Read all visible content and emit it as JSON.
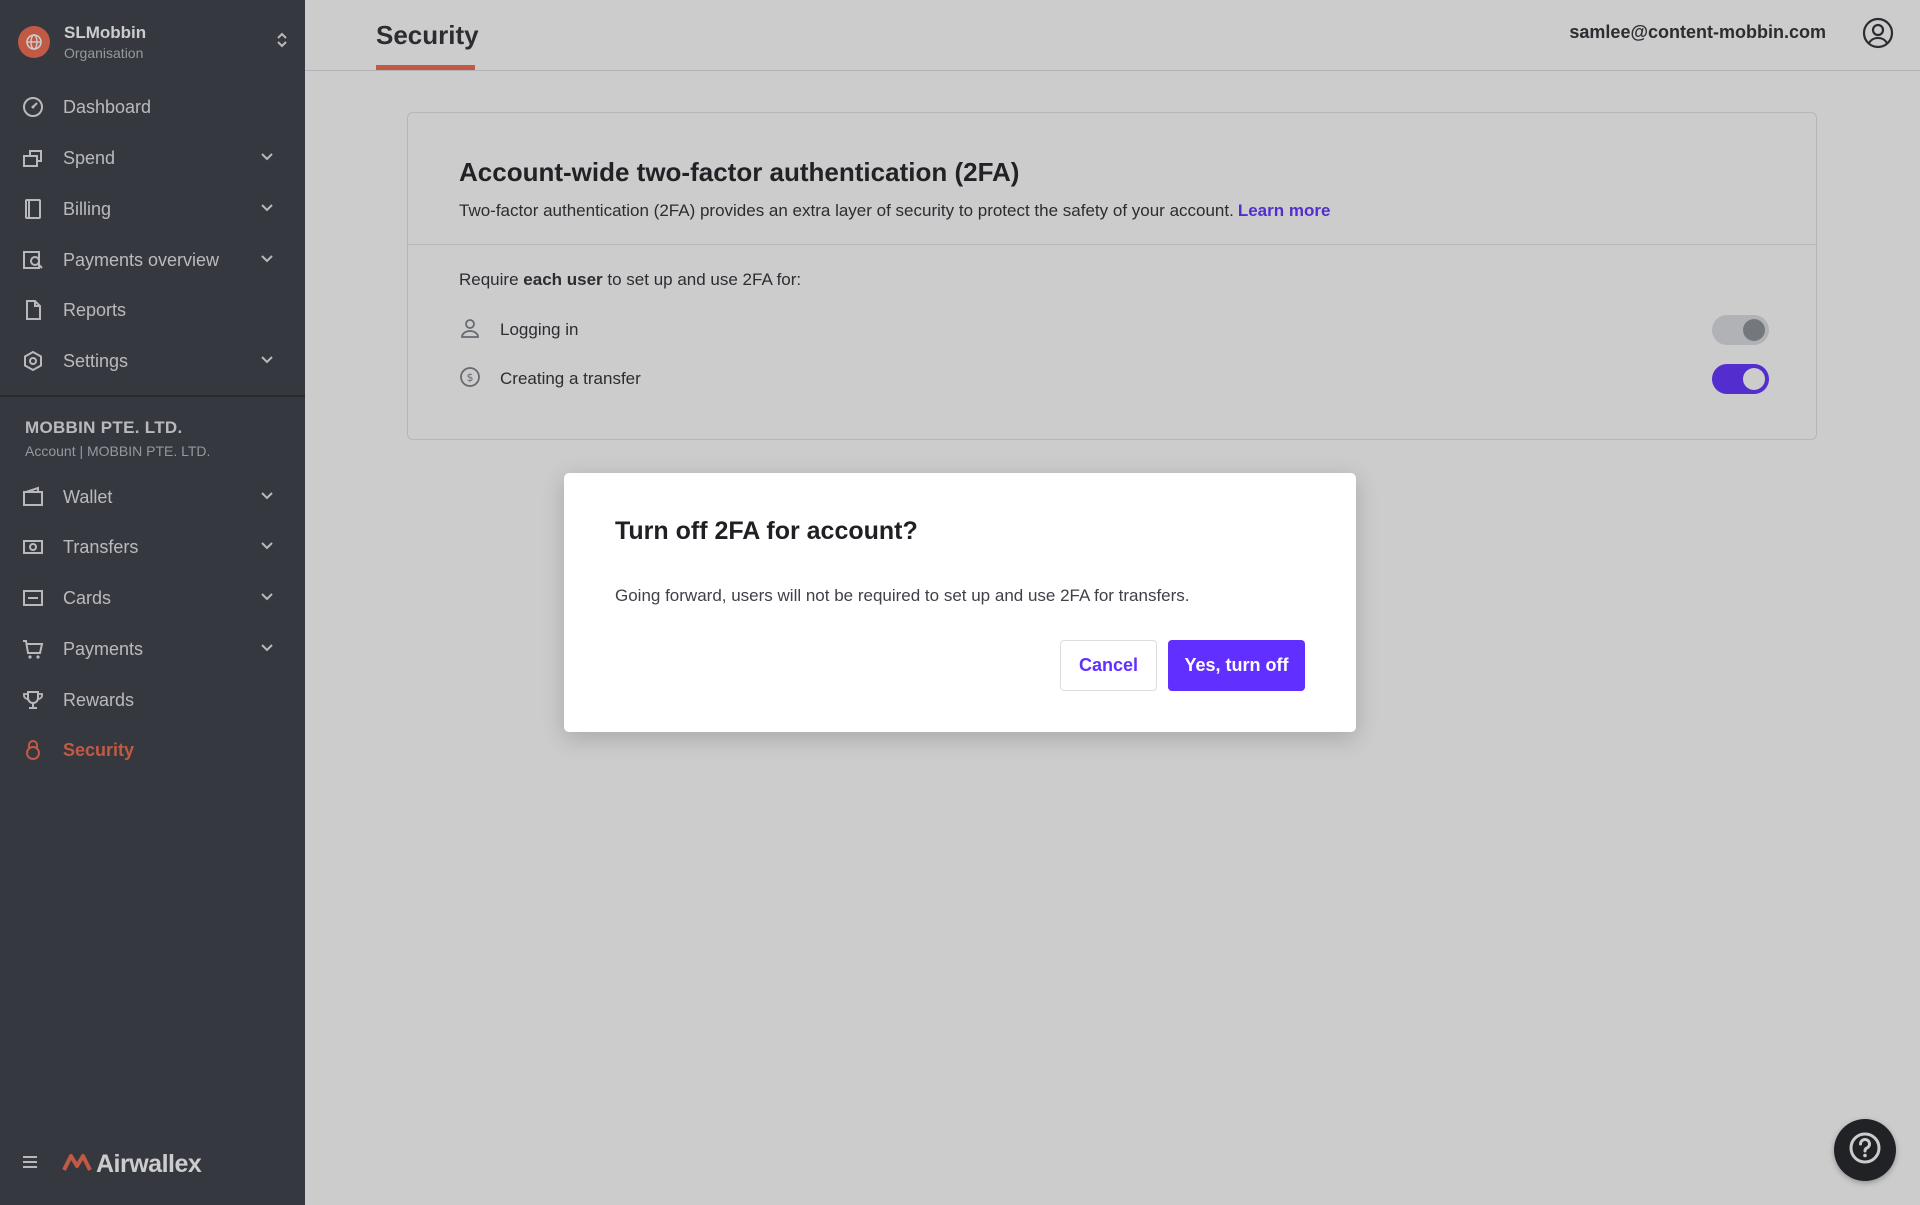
{
  "colors": {
    "accent": "#f06a4c",
    "primary": "#612fff",
    "sidebar_bg": "#3a3d45"
  },
  "org": {
    "name": "SLMobbin",
    "subtitle": "Organisation"
  },
  "nav_top": [
    {
      "label": "Dashboard",
      "icon": "dashboard-icon"
    },
    {
      "label": "Spend",
      "icon": "spend-icon"
    },
    {
      "label": "Billing",
      "icon": "billing-icon"
    },
    {
      "label": "Payments overview",
      "icon": "payments-overview-icon"
    },
    {
      "label": "Reports",
      "icon": "reports-icon"
    },
    {
      "label": "Settings",
      "icon": "settings-icon"
    }
  ],
  "account": {
    "name": "MOBBIN PTE. LTD.",
    "subtitle": "Account | MOBBIN PTE. LTD."
  },
  "nav_account": [
    {
      "label": "Wallet",
      "icon": "wallet-icon"
    },
    {
      "label": "Transfers",
      "icon": "transfers-icon"
    },
    {
      "label": "Cards",
      "icon": "cards-icon"
    },
    {
      "label": "Payments",
      "icon": "cart-icon"
    },
    {
      "label": "Rewards",
      "icon": "trophy-icon"
    },
    {
      "label": "Security",
      "icon": "lock-icon",
      "active": true
    }
  ],
  "brand": {
    "name": "Airwallex"
  },
  "header": {
    "tab": "Security",
    "email": "samlee@content-mobbin.com"
  },
  "card": {
    "title": "Account-wide two-factor authentication (2FA)",
    "description": "Two-factor authentication (2FA) provides an extra layer of security to protect the safety of your account.",
    "learn_more": "Learn more",
    "require_prefix": "Require",
    "require_bold": "each user",
    "require_suffix": "to set up and use 2FA for:",
    "options": [
      {
        "label": "Logging in",
        "icon": "user-icon",
        "enabled": false
      },
      {
        "label": "Creating a transfer",
        "icon": "dollar-icon",
        "enabled": true
      }
    ]
  },
  "modal": {
    "title": "Turn off 2FA for account?",
    "body": "Going forward, users will not be required to set up and use 2FA for transfers.",
    "cancel": "Cancel",
    "confirm": "Yes, turn off"
  }
}
